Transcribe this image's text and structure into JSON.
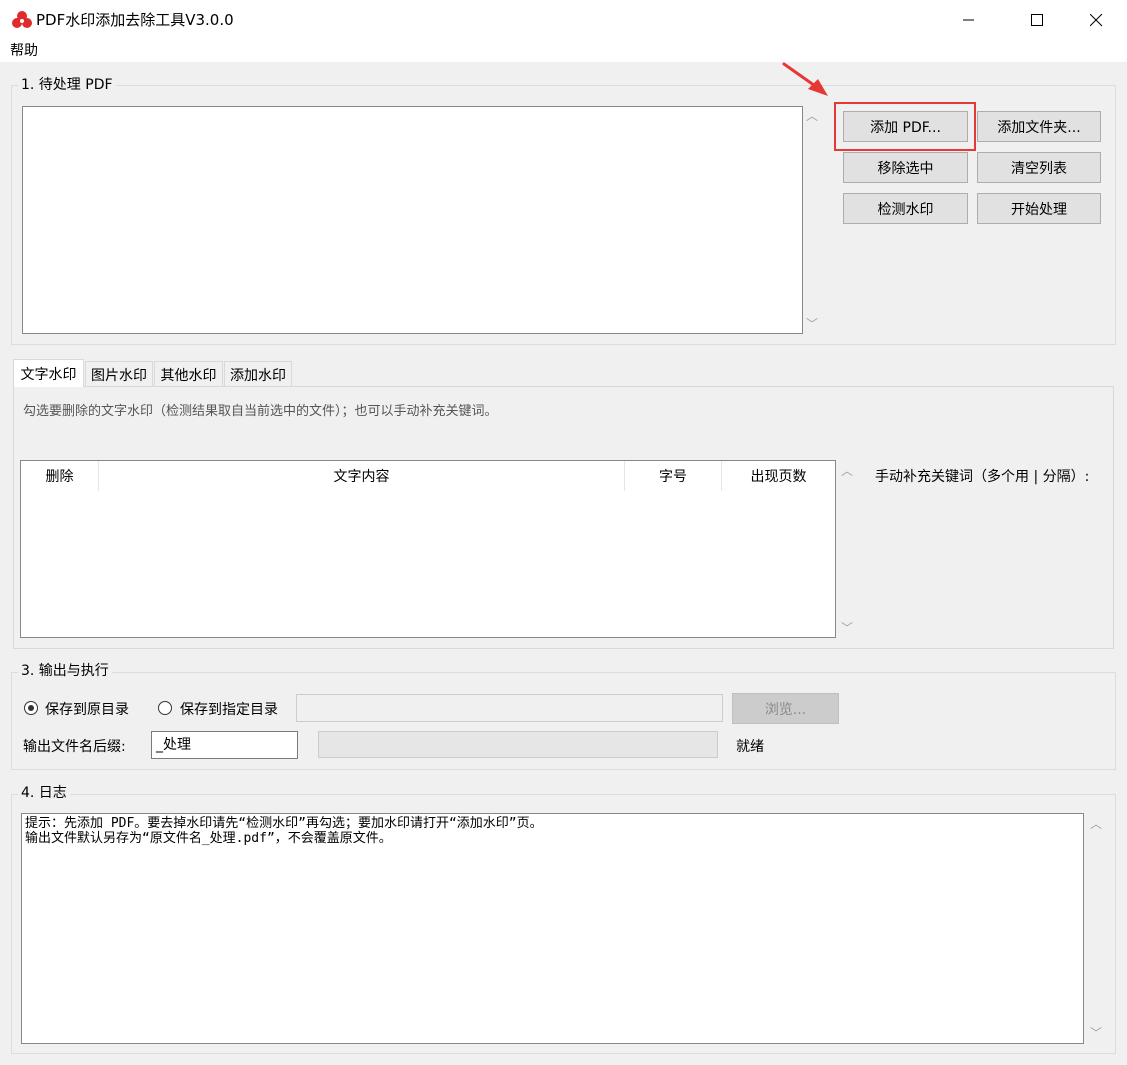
{
  "window": {
    "title": "PDF水印添加去除工具V3.0.0",
    "minimize_glyph": "—",
    "maximize_glyph": "☐",
    "close_glyph": "✕"
  },
  "menu": {
    "help": "帮助"
  },
  "section1": {
    "legend": "1. 待处理 PDF",
    "buttons": {
      "add_pdf": "添加 PDF...",
      "add_folder": "添加文件夹...",
      "remove_selected": "移除选中",
      "clear_list": "清空列表",
      "detect_watermark": "检测水印",
      "start_process": "开始处理"
    }
  },
  "tabs": [
    "文字水印",
    "图片水印",
    "其他水印",
    "添加水印"
  ],
  "text_tab": {
    "hint": "勾选要删除的文字水印（检测结果取自当前选中的文件）；也可以手动补充关键词。",
    "columns": [
      "删除",
      "文字内容",
      "字号",
      "出现页数"
    ],
    "manual_label": "手动补充关键词（多个用 | 分隔）:"
  },
  "section3": {
    "legend": "3. 输出与执行",
    "radio_original": "保存到原目录",
    "radio_custom": "保存到指定目录",
    "selected_option": "保存到原目录",
    "browse_button": "浏览...",
    "suffix_label": "输出文件名后缀:",
    "suffix_value": "_处理",
    "status": "就绪"
  },
  "section4": {
    "legend": "4. 日志",
    "lines": [
      "提示：先添加 PDF。要去掉水印请先“检测水印”再勾选；要加水印请打开“添加水印”页。",
      "输出文件默认另存为“原文件名_处理.pdf”，不会覆盖原文件。"
    ]
  },
  "icons": {
    "app": "red-flower-icon",
    "scroll_up": "chevron-up-icon",
    "scroll_down": "chevron-down-icon",
    "annotation": "red-arrow-icon"
  },
  "colors": {
    "highlight": "#e53935",
    "arrow": "#e53935"
  }
}
